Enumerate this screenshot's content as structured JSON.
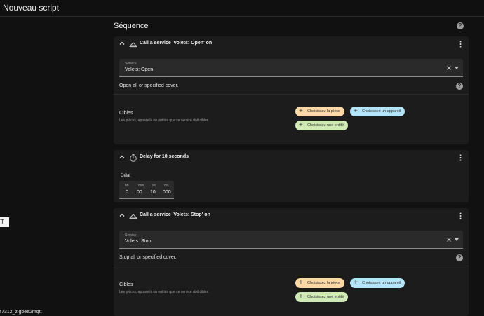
{
  "topbar": {
    "title": "Nouveau script"
  },
  "left": {
    "tag": "TT",
    "footer": "f7312_zigbee2mqtt"
  },
  "sequence": {
    "title": "Séquence",
    "help": "?"
  },
  "cards": [
    {
      "title": "Call a service 'Volets: Open' on",
      "service_label": "Service",
      "service_value": "Volets: Open",
      "description": "Open all or specified cover.",
      "help": "?",
      "cibles_title": "Cibles",
      "cibles_sub": "Les pièces, appareils ou entités que ce service doit cibler.",
      "chip_room": "Choisissez la pièce",
      "chip_device": "Choisissez un appareil",
      "chip_entity": "Choisissez une entité"
    },
    {
      "title": "Delay for 10 seconds",
      "delay_label": "Délai",
      "units": {
        "hh": "hh",
        "mm": "mm",
        "ss": "ss",
        "ms": "ms"
      },
      "values": {
        "hh": "0",
        "mm": "00",
        "ss": "10",
        "ms": "000"
      },
      "sep": ":"
    },
    {
      "title": "Call a service 'Volets: Stop' on",
      "service_label": "Service",
      "service_value": "Volets: Stop",
      "description": "Stop all or specified cover.",
      "help": "?",
      "cibles_title": "Cibles",
      "cibles_sub": "Les pièces, appareils ou entités que ce service doit cibler.",
      "chip_room": "Choisissez la pièce",
      "chip_device": "Choisissez un appareil",
      "chip_entity": "Choisissez une entité"
    }
  ],
  "colors": {
    "background": "#111111",
    "card": "#1c1c1c",
    "chip_room": "#fcd8a6",
    "chip_device": "#b3e4f7",
    "chip_entity": "#cfeab4"
  }
}
